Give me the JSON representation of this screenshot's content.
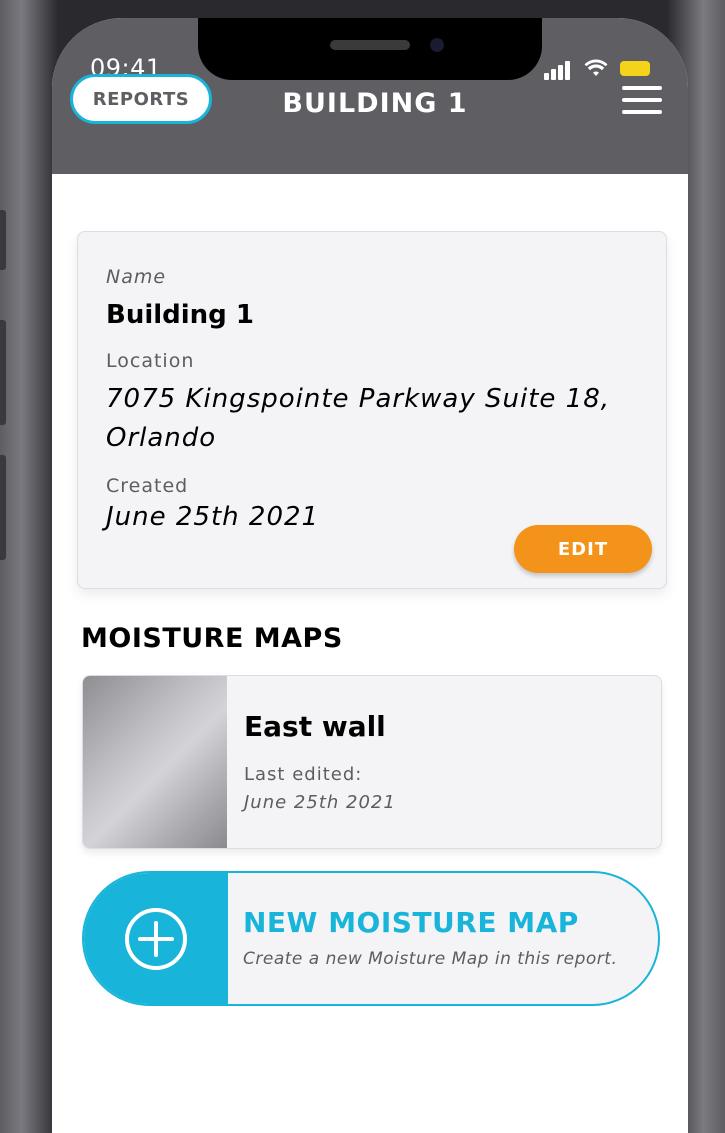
{
  "status_bar": {
    "time": "09:41",
    "icons": [
      "signal-icon",
      "wifi-icon",
      "battery-icon"
    ]
  },
  "header": {
    "back_label": "REPORTS",
    "title": "BUILDING 1",
    "menu_icon": "hamburger-menu-icon"
  },
  "building": {
    "name_label": "Name",
    "name_value": "Building 1",
    "location_label": "Location",
    "location_value": "7075 Kingspointe Parkway Suite 18, Orlando",
    "created_label": "Created",
    "created_value": "June 25th 2021",
    "edit_label": "EDIT"
  },
  "moisture_maps": {
    "section_title": "MOISTURE MAPS",
    "items": [
      {
        "title": "East wall",
        "edited_label": "Last edited:",
        "edited_date": "June 25th 2021"
      }
    ],
    "new_map": {
      "title": "NEW MOISTURE MAP",
      "subtitle": "Create a new Moisture Map in this report.",
      "icon": "plus-circle-icon"
    }
  },
  "colors": {
    "accent": "#19b4d9",
    "edit_button": "#f39319",
    "header_bg": "#5e5e63",
    "battery": "#f5d31b"
  }
}
